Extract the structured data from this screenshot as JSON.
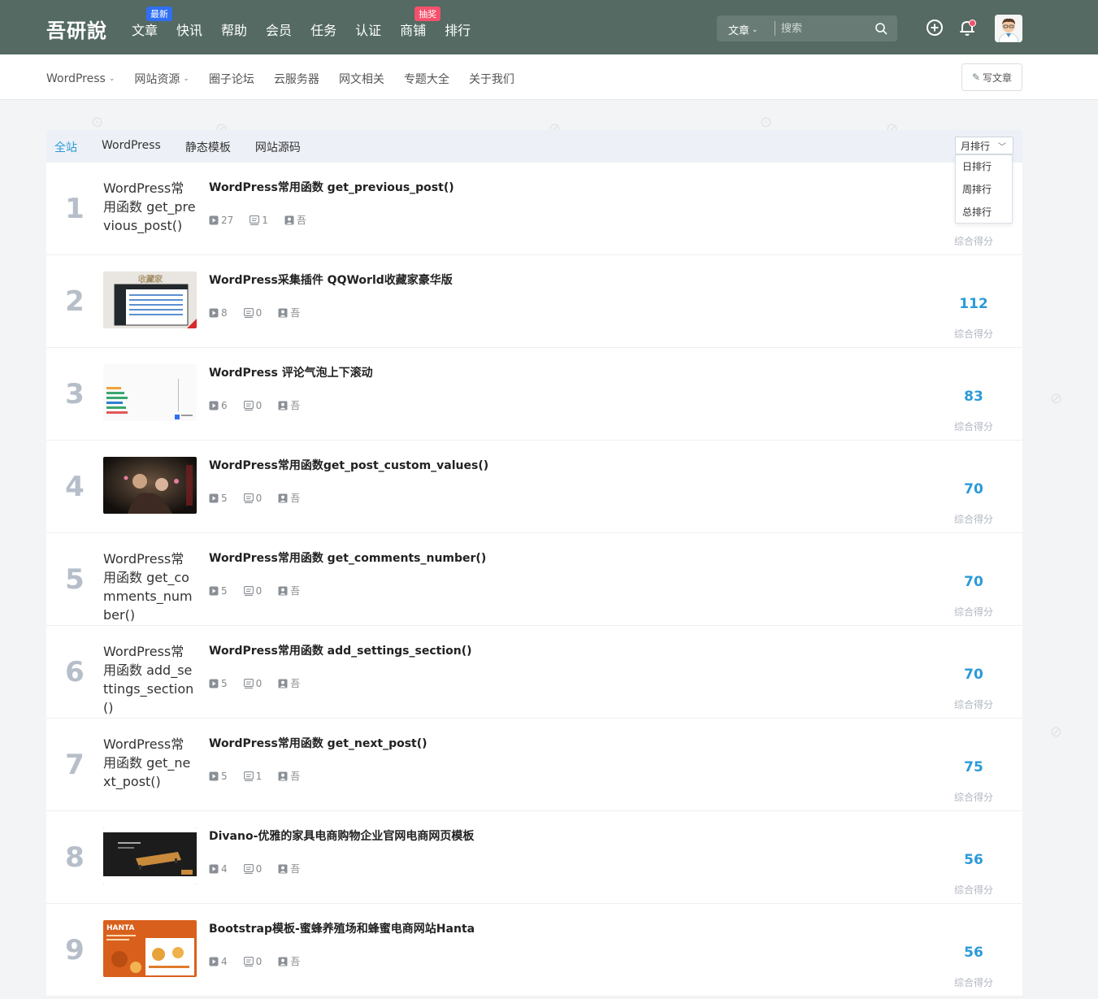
{
  "site": {
    "logo": "吾研說"
  },
  "topnav": [
    {
      "label": "文章",
      "badge": "最新",
      "badge_color": "blue"
    },
    {
      "label": "快讯",
      "badge": "",
      "badge_color": ""
    },
    {
      "label": "帮助",
      "badge": "",
      "badge_color": ""
    },
    {
      "label": "会员",
      "badge": "",
      "badge_color": ""
    },
    {
      "label": "任务",
      "badge": "",
      "badge_color": ""
    },
    {
      "label": "认证",
      "badge": "",
      "badge_color": ""
    },
    {
      "label": "商铺",
      "badge": "抽奖",
      "badge_color": "red"
    },
    {
      "label": "排行",
      "badge": "",
      "badge_color": ""
    }
  ],
  "search": {
    "type_label": "文章",
    "placeholder": "搜索"
  },
  "subnav": [
    {
      "label": "WordPress",
      "dropdown": true
    },
    {
      "label": "网站资源",
      "dropdown": true
    },
    {
      "label": "圈子论坛",
      "dropdown": false
    },
    {
      "label": "云服务器",
      "dropdown": false
    },
    {
      "label": "网文相关",
      "dropdown": false
    },
    {
      "label": "专题大全",
      "dropdown": false
    },
    {
      "label": "关于我们",
      "dropdown": false
    }
  ],
  "write_button": "写文章",
  "tabs": [
    {
      "label": "全站",
      "active": true
    },
    {
      "label": "WordPress",
      "active": false
    },
    {
      "label": "静态模板",
      "active": false
    },
    {
      "label": "网站源码",
      "active": false
    }
  ],
  "rank_select": {
    "selected": "月排行",
    "options": [
      "日排行",
      "周排行",
      "总排行"
    ]
  },
  "score_label": "综合得分",
  "colors": {
    "header_bg": "#546a62",
    "accent": "#2b9ad8",
    "rank_num": "#b6bec9"
  },
  "posts": [
    {
      "rank": "1",
      "title": "WordPress常用函数 get_previous_post()",
      "thumb_alt": "WordPress常用函数 get_previous_post()",
      "thumb": "broken",
      "views": "27",
      "comments": "1",
      "author": "吾",
      "score": ""
    },
    {
      "rank": "2",
      "title": "WordPress采集插件 QQWorld收藏家豪华版",
      "thumb_alt": "",
      "thumb": "collector",
      "views": "8",
      "comments": "0",
      "author": "吾",
      "score": "112"
    },
    {
      "rank": "3",
      "title": "WordPress 评论气泡上下滚动",
      "thumb_alt": "",
      "thumb": "bubbles",
      "views": "6",
      "comments": "0",
      "author": "吾",
      "score": "83"
    },
    {
      "rank": "4",
      "title": "WordPress常用函数get_post_custom_values()",
      "thumb_alt": "",
      "thumb": "dark",
      "views": "5",
      "comments": "0",
      "author": "吾",
      "score": "70"
    },
    {
      "rank": "5",
      "title": "WordPress常用函数 get_comments_number()",
      "thumb_alt": "WordPress常用函数 get_comments_number()",
      "thumb": "broken",
      "views": "5",
      "comments": "0",
      "author": "吾",
      "score": "70"
    },
    {
      "rank": "6",
      "title": "WordPress常用函数 add_settings_section()",
      "thumb_alt": "WordPress常用函数 add_settings_section()",
      "thumb": "broken",
      "views": "5",
      "comments": "0",
      "author": "吾",
      "score": "70"
    },
    {
      "rank": "7",
      "title": "WordPress常用函数 get_next_post()",
      "thumb_alt": "WordPress常用函数 get_next_post()",
      "thumb": "broken",
      "views": "5",
      "comments": "1",
      "author": "吾",
      "score": "75"
    },
    {
      "rank": "8",
      "title": "Divano-优雅的家具电商购物企业官网电商网页模板",
      "thumb_alt": "",
      "thumb": "furniture",
      "views": "4",
      "comments": "0",
      "author": "吾",
      "score": "56"
    },
    {
      "rank": "9",
      "title": "Bootstrap模板-蜜蜂养殖场和蜂蜜电商网站Hanta",
      "thumb_alt": "",
      "thumb": "hanta",
      "views": "4",
      "comments": "0",
      "author": "吾",
      "score": "56"
    }
  ],
  "thumb_text": {
    "collector": "收藏家",
    "hanta": "HANTA"
  }
}
